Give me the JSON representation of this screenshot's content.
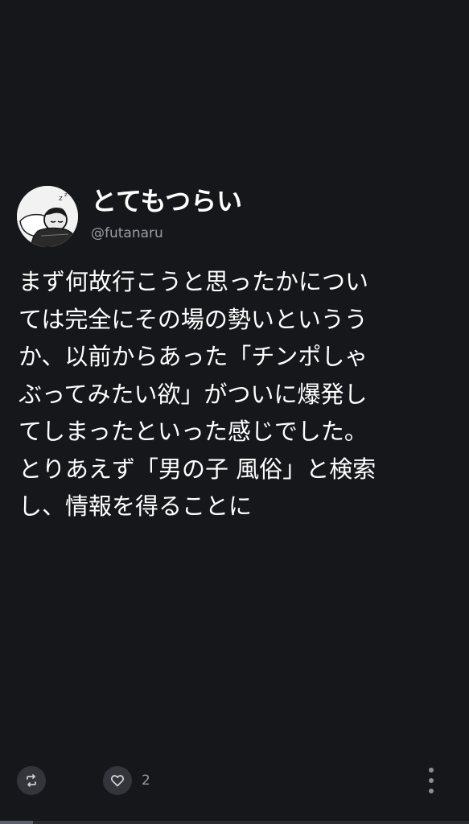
{
  "post": {
    "author": {
      "display_name": "とてもつらい",
      "handle": "@futanaru",
      "avatar_icon": "sleeping-character-avatar"
    },
    "text_lines": [
      "まず何故行こうと思ったかについ",
      "ては完全にその場の勢いというう",
      "か、以前からあった「チンポしゃ",
      "ぶってみたい欲」がついに爆発し",
      "てしまったといった感じでした。",
      "とりあえず「男の子 風俗」と検索",
      "し、情報を得ることに"
    ],
    "actions": {
      "retweet_icon": "retweet-icon",
      "like_icon": "heart-icon",
      "like_count": "2",
      "more_icon": "more-vertical-icon"
    }
  },
  "media_progress": {
    "value": 0.07
  },
  "colors": {
    "background": "#16171b",
    "text_primary": "#ffffff",
    "text_secondary": "#9a9ca3",
    "action_bg": "#33353b"
  }
}
